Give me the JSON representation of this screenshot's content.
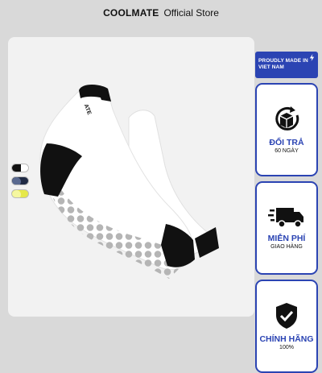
{
  "header": {
    "brand": "COOLMATE",
    "store": "Official Store"
  },
  "product": {
    "sock_label": "ATE"
  },
  "swatches": [
    {
      "name": "white-black",
      "color": "#ffffff",
      "accent": "#111111"
    },
    {
      "name": "navy",
      "color": "#1f2a44",
      "accent": "#111111"
    },
    {
      "name": "yellow",
      "color": "#e6e84a",
      "accent": "#aaaaaa"
    }
  ],
  "made_in": {
    "line1": "PROUDLY MADE IN",
    "line2": "VIET NAM"
  },
  "badges": [
    {
      "icon": "return-box-icon",
      "title": "ĐỔI TRẢ",
      "subtitle": "60 NGÀY"
    },
    {
      "icon": "delivery-truck-icon",
      "title": "MIỄN PHÍ",
      "subtitle": "GIAO HÀNG"
    },
    {
      "icon": "shield-check-icon",
      "title": "CHÍNH HÃNG",
      "subtitle": "100%"
    }
  ],
  "colors": {
    "accent": "#2b44b3",
    "background": "#d9d9d9"
  }
}
